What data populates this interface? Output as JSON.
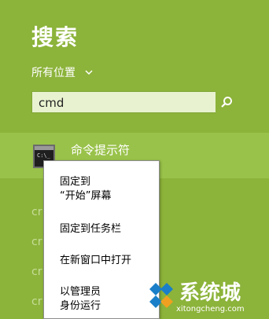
{
  "header": {
    "title": "搜索"
  },
  "scope": {
    "label": "所有位置"
  },
  "search": {
    "value": "cmd"
  },
  "result": {
    "label": "命令提示符",
    "icon_text": "C:\\_"
  },
  "faded_items": [
    "cr",
    "cr",
    "cr",
    "cr",
    "cr"
  ],
  "context_menu": {
    "pin_start_line1": "固定到",
    "pin_start_line2": "“开始”屏幕",
    "pin_taskbar": "固定到任务栏",
    "open_new_window": "在新窗口中打开",
    "run_admin_line1": "以管理员",
    "run_admin_line2": "身份运行"
  },
  "watermark": {
    "brand": "系统城",
    "url": "xitongcheng.com"
  },
  "colors": {
    "background": "#8cb33a",
    "highlight": "#99c24a",
    "menu": "#ffffff"
  }
}
